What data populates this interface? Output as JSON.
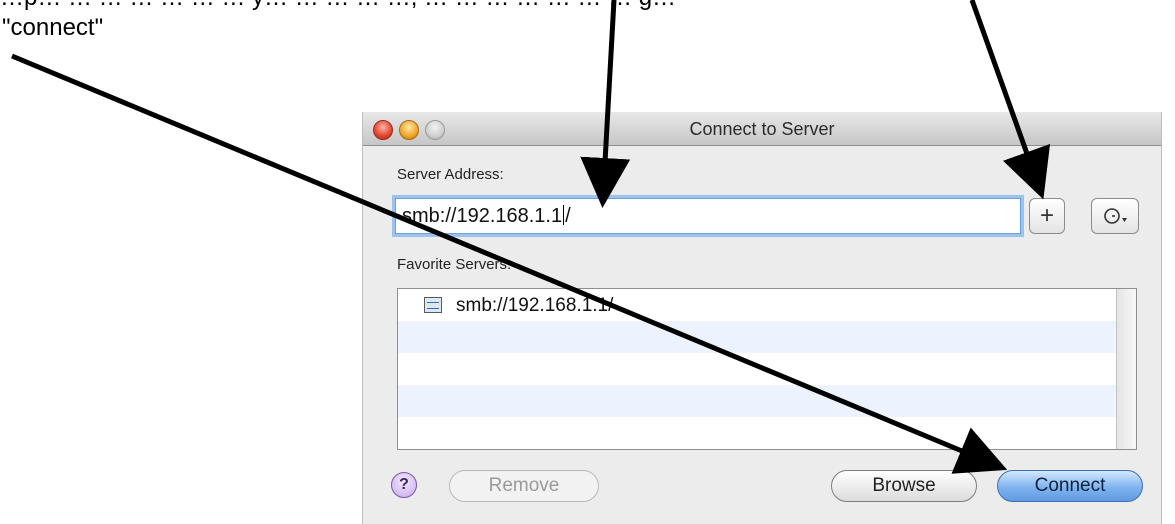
{
  "annotations": {
    "top_text": "…p… … … … … … … y… … … … …, … … … … … … … g…",
    "connect_text": "\"connect\""
  },
  "window": {
    "title": "Connect to Server"
  },
  "form": {
    "server_address_label": "Server Address:",
    "address_value_before_caret": "smb://192.168.1.1",
    "address_value_after_caret": "/",
    "favorites_label": "Favorite Servers:",
    "favorites": [
      "smb://192.168.1.1/",
      "",
      "",
      "",
      ""
    ]
  },
  "buttons": {
    "add": "+",
    "recent": "⊙",
    "help": "?",
    "remove": "Remove",
    "browse": "Browse",
    "connect": "Connect"
  },
  "colors": {
    "accent": "#6fa1d8",
    "connect_button": "#7fb3ee",
    "list_alt_row": "#edf3fe"
  },
  "icons": {
    "server": "server-icon",
    "arrow": "arrow-annotation"
  }
}
